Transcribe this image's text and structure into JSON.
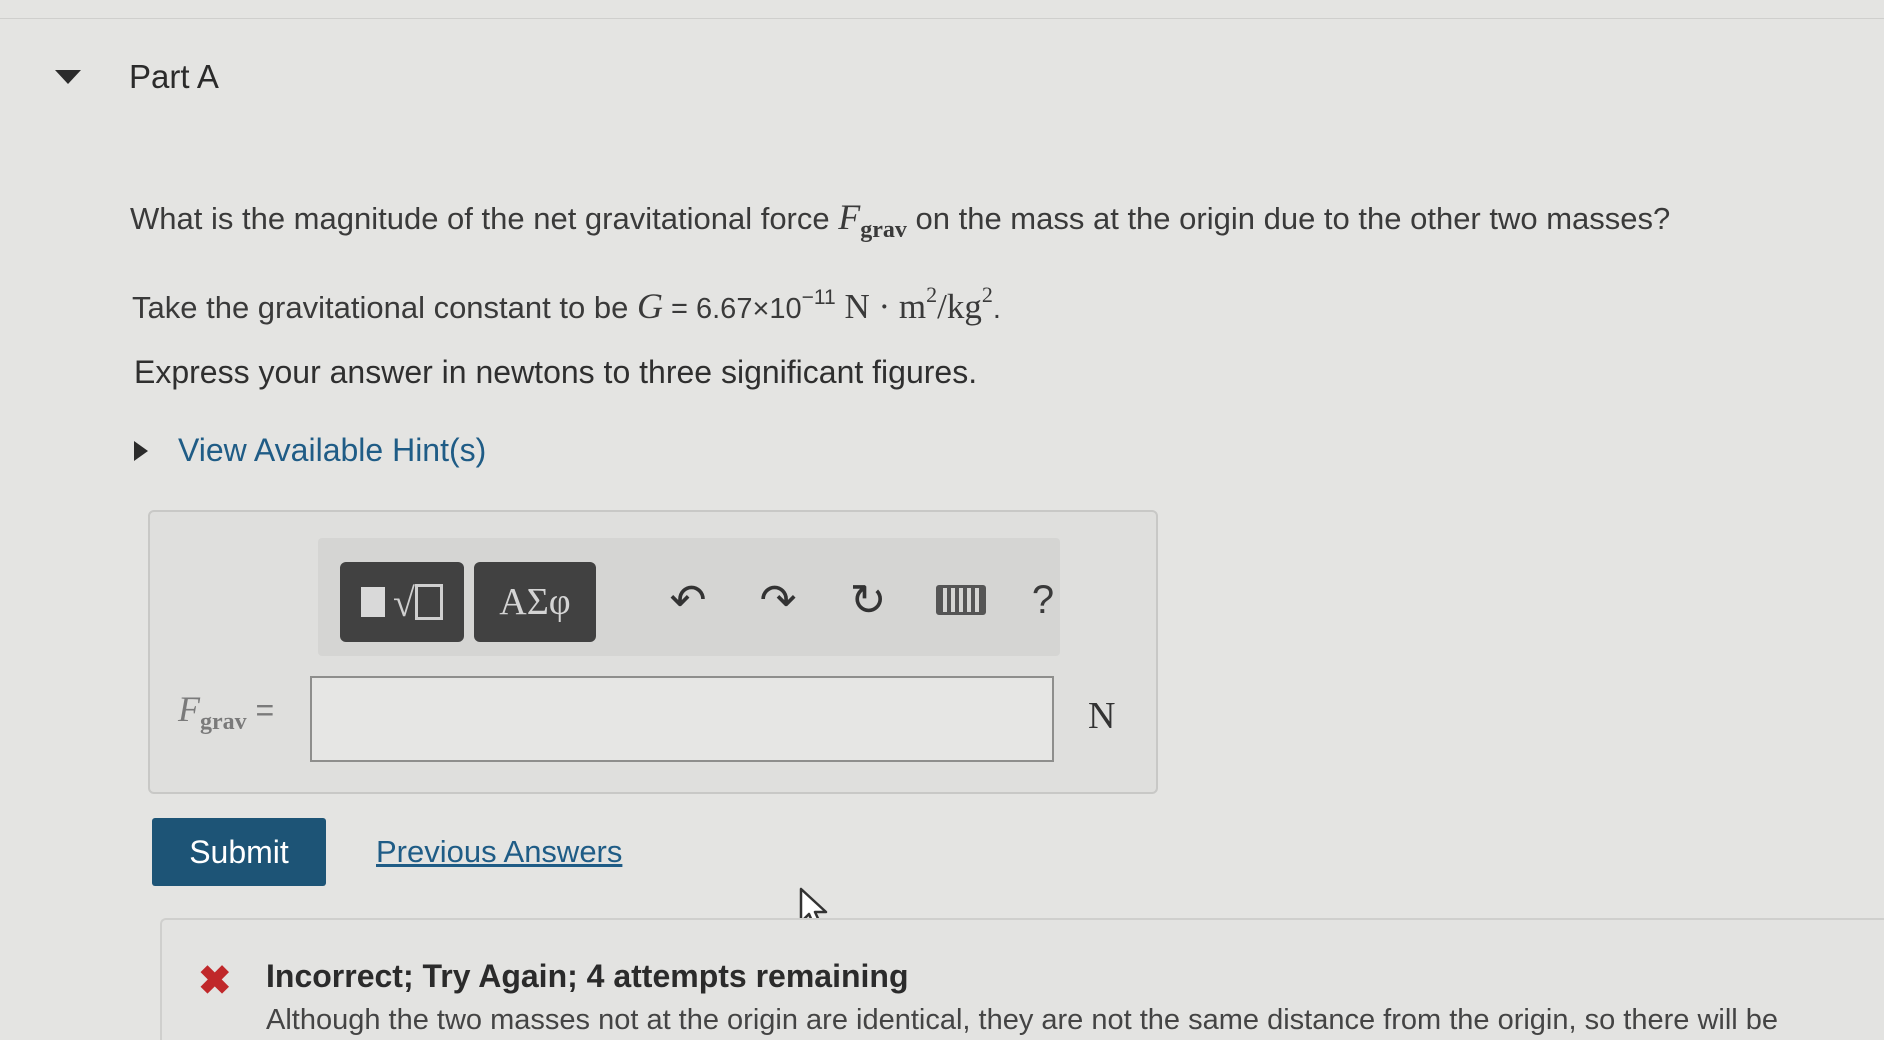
{
  "part": {
    "title": "Part A"
  },
  "question": {
    "prefix": "What is the magnitude of the net gravitational force ",
    "symbol": "F",
    "subscript": "grav",
    "suffix": " on the mass at the origin due to the other two masses?"
  },
  "constant": {
    "prefix": "Take the gravitational constant to be ",
    "symbol": "G",
    "equals": " = ",
    "value": "6.67×10",
    "exponent": "−11",
    "unit_a": " N · m",
    "unit_a_sup": "2",
    "unit_b": "/kg",
    "unit_b_sup": "2",
    "end": "."
  },
  "instruction": "Express your answer in newtons to three significant figures.",
  "hint_link": "View Available Hint(s)",
  "toolbar": {
    "greek_label": "ΑΣφ",
    "undo_glyph": "↶",
    "redo_glyph": "↷",
    "reset_glyph": "↻",
    "help_glyph": "?"
  },
  "answer": {
    "symbol": "F",
    "subscript": "grav",
    "equals": " =",
    "value": "",
    "unit": "N"
  },
  "submit_label": "Submit",
  "previous_answers_label": "Previous Answers",
  "feedback": {
    "icon_glyph": "✖",
    "title": "Incorrect; Try Again; 4 attempts remaining",
    "text": "Although the two masses not at the origin are identical, they are not the same distance from the origin, so there will be"
  },
  "colors": {
    "accent": "#1d5476",
    "link": "#1f5c86",
    "error": "#c0282a"
  }
}
